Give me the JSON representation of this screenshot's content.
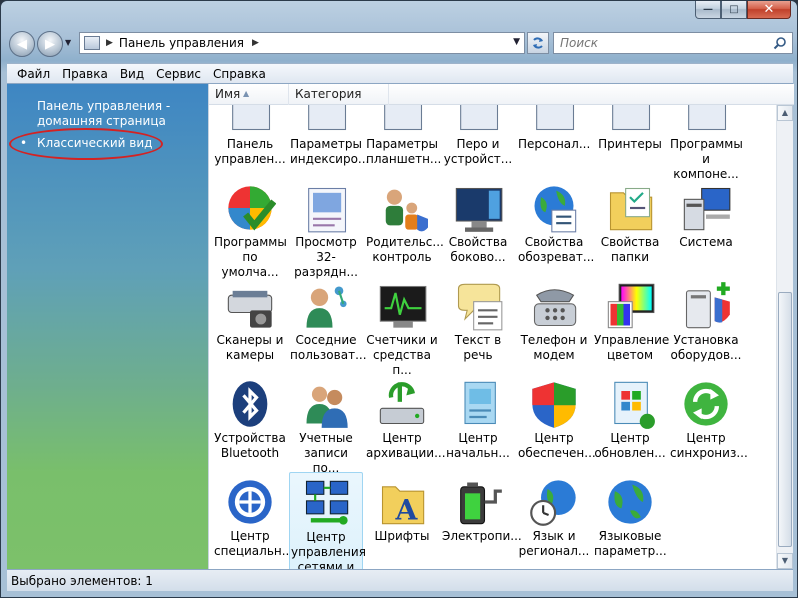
{
  "window": {
    "caption": {
      "minimize_glyph": "—",
      "maximize_glyph": "□",
      "close_glyph": "✕"
    }
  },
  "nav": {
    "address": "Панель управления",
    "search_placeholder": "Поиск"
  },
  "menu": [
    "Файл",
    "Правка",
    "Вид",
    "Сервис",
    "Справка"
  ],
  "left_pane": {
    "home_link": "Панель управления - домашняя страница",
    "classic_link": "Классический вид"
  },
  "columns": {
    "name": "Имя",
    "category": "Категория"
  },
  "items": [
    {
      "label": "Панель управлен...",
      "icon": "control-panel-icon"
    },
    {
      "label": "Параметры индексиро...",
      "icon": "indexing-icon"
    },
    {
      "label": "Параметры планшетн...",
      "icon": "tablet-icon"
    },
    {
      "label": "Перо и устройст...",
      "icon": "pen-icon"
    },
    {
      "label": "Персонал...",
      "icon": "personalization-icon"
    },
    {
      "label": "Принтеры",
      "icon": "printer-icon"
    },
    {
      "label": "Программы и компоне...",
      "icon": "programs-icon"
    },
    {
      "label": "Программы по умолча...",
      "icon": "default-programs-icon"
    },
    {
      "label": "Просмотр 32-разрядн...",
      "icon": "viewer-32bit-icon"
    },
    {
      "label": "Родительс... контроль",
      "icon": "parental-control-icon"
    },
    {
      "label": "Свойства боково...",
      "icon": "sidebar-properties-icon"
    },
    {
      "label": "Свойства обозреват...",
      "icon": "internet-options-icon"
    },
    {
      "label": "Свойства папки",
      "icon": "folder-options-icon"
    },
    {
      "label": "Система",
      "icon": "system-icon"
    },
    {
      "label": "Сканеры и камеры",
      "icon": "scanner-camera-icon"
    },
    {
      "label": "Соседние пользоват...",
      "icon": "people-near-me-icon"
    },
    {
      "label": "Счетчики и средства п...",
      "icon": "performance-icon"
    },
    {
      "label": "Текст в речь",
      "icon": "text-to-speech-icon"
    },
    {
      "label": "Телефон и модем",
      "icon": "phone-modem-icon"
    },
    {
      "label": "Управление цветом",
      "icon": "color-management-icon"
    },
    {
      "label": "Установка оборудов...",
      "icon": "add-hardware-icon"
    },
    {
      "label": "Устройства Bluetooth",
      "icon": "bluetooth-icon"
    },
    {
      "label": "Учетные записи по...",
      "icon": "user-accounts-icon"
    },
    {
      "label": "Центр архивации...",
      "icon": "backup-center-icon"
    },
    {
      "label": "Центр начальн...",
      "icon": "welcome-center-icon"
    },
    {
      "label": "Центр обеспечен...",
      "icon": "security-center-icon"
    },
    {
      "label": "Центр обновлен...",
      "icon": "windows-update-icon"
    },
    {
      "label": "Центр синхрониз...",
      "icon": "sync-center-icon"
    },
    {
      "label": "Центр специальн...",
      "icon": "ease-of-access-icon"
    },
    {
      "label": "Центр управления сетями и общим доступом",
      "icon": "network-center-icon",
      "selected": true
    },
    {
      "label": "Шрифты",
      "icon": "fonts-icon"
    },
    {
      "label": "Электропи...",
      "icon": "power-options-icon"
    },
    {
      "label": "Язык и регионал...",
      "icon": "regional-icon"
    },
    {
      "label": "Языковые параметр...",
      "icon": "language-icon"
    }
  ],
  "status": "Выбрано элементов: 1"
}
